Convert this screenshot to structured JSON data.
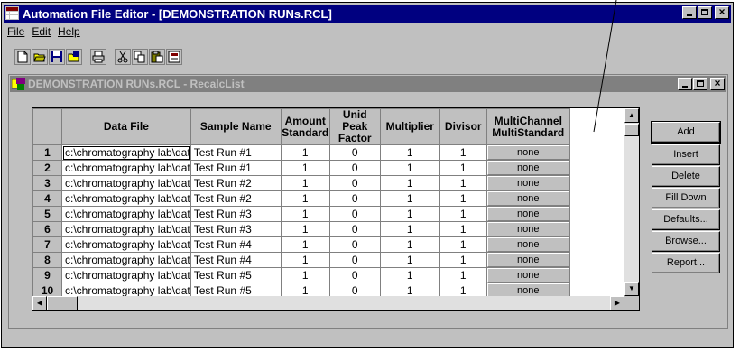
{
  "window": {
    "title": "Automation File Editor - [DEMONSTRATION RUNs.RCL]",
    "controls": [
      "minimize",
      "maximize",
      "close"
    ]
  },
  "menu": [
    {
      "label": "File",
      "accel": "F"
    },
    {
      "label": "Edit",
      "accel": "E"
    },
    {
      "label": "Help",
      "accel": "H"
    }
  ],
  "toolbar": [
    {
      "name": "new-icon",
      "glyph": "🗋"
    },
    {
      "name": "open-icon",
      "glyph": "📂"
    },
    {
      "name": "save-icon",
      "glyph": "💾"
    },
    {
      "name": "save-all-icon",
      "glyph": "📂"
    },
    {
      "name": "print-icon",
      "glyph": "🖶"
    },
    {
      "name": "cut-icon",
      "glyph": "✂"
    },
    {
      "name": "copy-icon",
      "glyph": "⎘"
    },
    {
      "name": "paste-icon",
      "glyph": "📋"
    },
    {
      "name": "report-icon",
      "glyph": "▣"
    }
  ],
  "child": {
    "title": "DEMONSTRATION RUNs.RCL - RecalcList",
    "controls": [
      "minimize",
      "maximize",
      "close"
    ]
  },
  "grid": {
    "columns": [
      "",
      "Data File",
      "Sample Name",
      "Amount Standard",
      "Unid Peak Factor",
      "Multiplier",
      "Divisor",
      "MultiChannel MultiStandard"
    ],
    "rows": [
      {
        "num": "1",
        "file": "c:\\chromatography lab\\dat",
        "sample": "Test Run #1",
        "amount": "1",
        "unid": "0",
        "mult": "1",
        "div": "1",
        "multich": "none"
      },
      {
        "num": "2",
        "file": "c:\\chromatography lab\\dat",
        "sample": "Test Run #1",
        "amount": "1",
        "unid": "0",
        "mult": "1",
        "div": "1",
        "multich": "none"
      },
      {
        "num": "3",
        "file": "c:\\chromatography lab\\dat",
        "sample": "Test Run #2",
        "amount": "1",
        "unid": "0",
        "mult": "1",
        "div": "1",
        "multich": "none"
      },
      {
        "num": "4",
        "file": "c:\\chromatography lab\\dat",
        "sample": "Test Run #2",
        "amount": "1",
        "unid": "0",
        "mult": "1",
        "div": "1",
        "multich": "none"
      },
      {
        "num": "5",
        "file": "c:\\chromatography lab\\dat",
        "sample": "Test Run #3",
        "amount": "1",
        "unid": "0",
        "mult": "1",
        "div": "1",
        "multich": "none"
      },
      {
        "num": "6",
        "file": "c:\\chromatography lab\\dat",
        "sample": "Test Run #3",
        "amount": "1",
        "unid": "0",
        "mult": "1",
        "div": "1",
        "multich": "none"
      },
      {
        "num": "7",
        "file": "c:\\chromatography lab\\dat",
        "sample": "Test Run #4",
        "amount": "1",
        "unid": "0",
        "mult": "1",
        "div": "1",
        "multich": "none"
      },
      {
        "num": "8",
        "file": "c:\\chromatography lab\\dat",
        "sample": "Test Run #4",
        "amount": "1",
        "unid": "0",
        "mult": "1",
        "div": "1",
        "multich": "none"
      },
      {
        "num": "9",
        "file": "c:\\chromatography lab\\dat",
        "sample": "Test Run #5",
        "amount": "1",
        "unid": "0",
        "mult": "1",
        "div": "1",
        "multich": "none"
      },
      {
        "num": "10",
        "file": "c:\\chromatography lab\\dat",
        "sample": "Test Run #5",
        "amount": "1",
        "unid": "0",
        "mult": "1",
        "div": "1",
        "multich": "none"
      }
    ]
  },
  "buttons": [
    {
      "label": "Add",
      "accel": "d"
    },
    {
      "label": "Insert",
      "accel": "I"
    },
    {
      "label": "Delete",
      "accel": "t"
    },
    {
      "label": "Fill Down",
      "accel": "o"
    },
    {
      "label": "Defaults...",
      "accel": "u"
    },
    {
      "label": "Browse...",
      "accel": "w"
    },
    {
      "label": "Report...",
      "accel": "R"
    }
  ],
  "colors": {
    "title_active": "#000080",
    "title_inactive": "#808080",
    "face": "#c0c0c0"
  }
}
